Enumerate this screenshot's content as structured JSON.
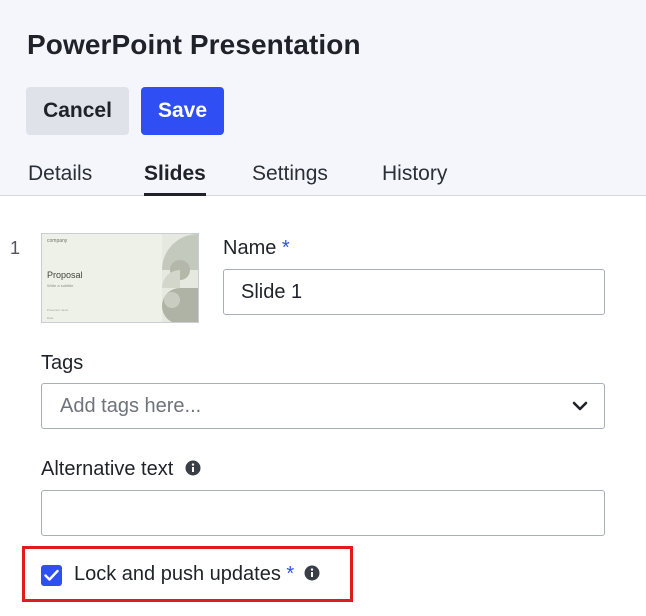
{
  "header": {
    "title": "PowerPoint Presentation",
    "cancel_label": "Cancel",
    "save_label": "Save"
  },
  "tabs": [
    {
      "label": "Details",
      "active": false
    },
    {
      "label": "Slides",
      "active": true
    },
    {
      "label": "Settings",
      "active": false
    },
    {
      "label": "History",
      "active": false
    }
  ],
  "slide": {
    "number": "1",
    "thumbnail": {
      "logo_text": "company",
      "heading": "Proposal",
      "subtitle": "Write a subtitle",
      "footer_line_1": "Presenter name",
      "footer_line_2": "Date"
    },
    "name_label": "Name",
    "name_required": "*",
    "name_value": "Slide 1"
  },
  "tags": {
    "label": "Tags",
    "placeholder": "Add tags here..."
  },
  "alt_text": {
    "label": "Alternative text",
    "value": ""
  },
  "lock": {
    "label": "Lock and push updates",
    "required": "*",
    "checked": true
  },
  "colors": {
    "accent": "#2f4ff5",
    "highlight": "#e11b1b",
    "header_bg": "#f4f6fc"
  },
  "icons": {
    "info": "info-circle-icon",
    "chevron": "chevron-down-icon",
    "check": "checkmark-icon"
  }
}
